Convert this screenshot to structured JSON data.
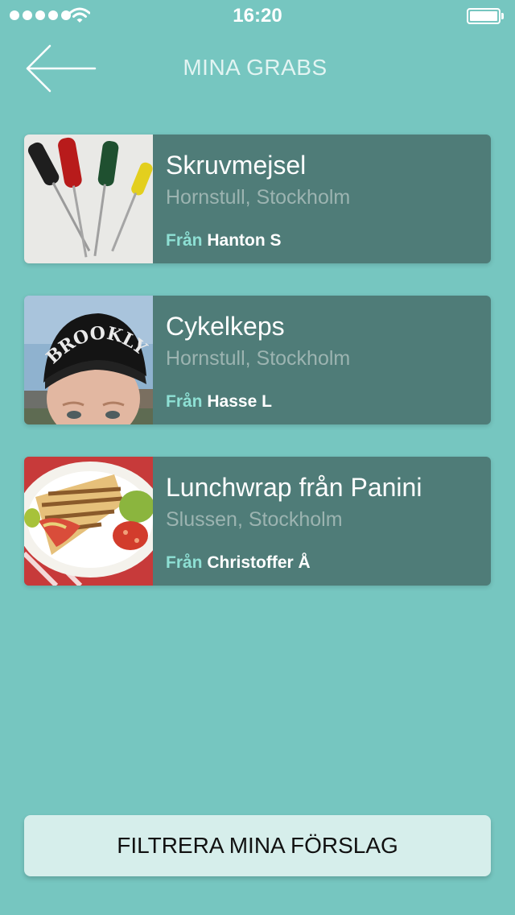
{
  "status_bar": {
    "time": "16:20",
    "signal_dots": 5
  },
  "nav": {
    "title": "MINA GRABS",
    "back_icon": "arrow-left-icon"
  },
  "grabs": [
    {
      "title": "Skruvmejsel",
      "location": "Hornstull, Stockholm",
      "from_label": "Från",
      "from_name": "Hanton S",
      "image": "screwdrivers-photo"
    },
    {
      "title": "Cykelkeps",
      "location": "Hornstull, Stockholm",
      "from_label": "Från",
      "from_name": "Hasse L",
      "image": "brooklyn-cap-photo"
    },
    {
      "title": "Lunchwrap från Panini",
      "location": "Slussen, Stockholm",
      "from_label": "Från",
      "from_name": "Christoffer Å",
      "image": "lunch-wrap-photo"
    }
  ],
  "filter_button": {
    "label": "FILTRERA MINA FÖRSLAG"
  },
  "colors": {
    "background": "#76c6c0",
    "card": "#4f7c78",
    "accent": "#8ee0d4",
    "button": "#d6eeeb"
  }
}
